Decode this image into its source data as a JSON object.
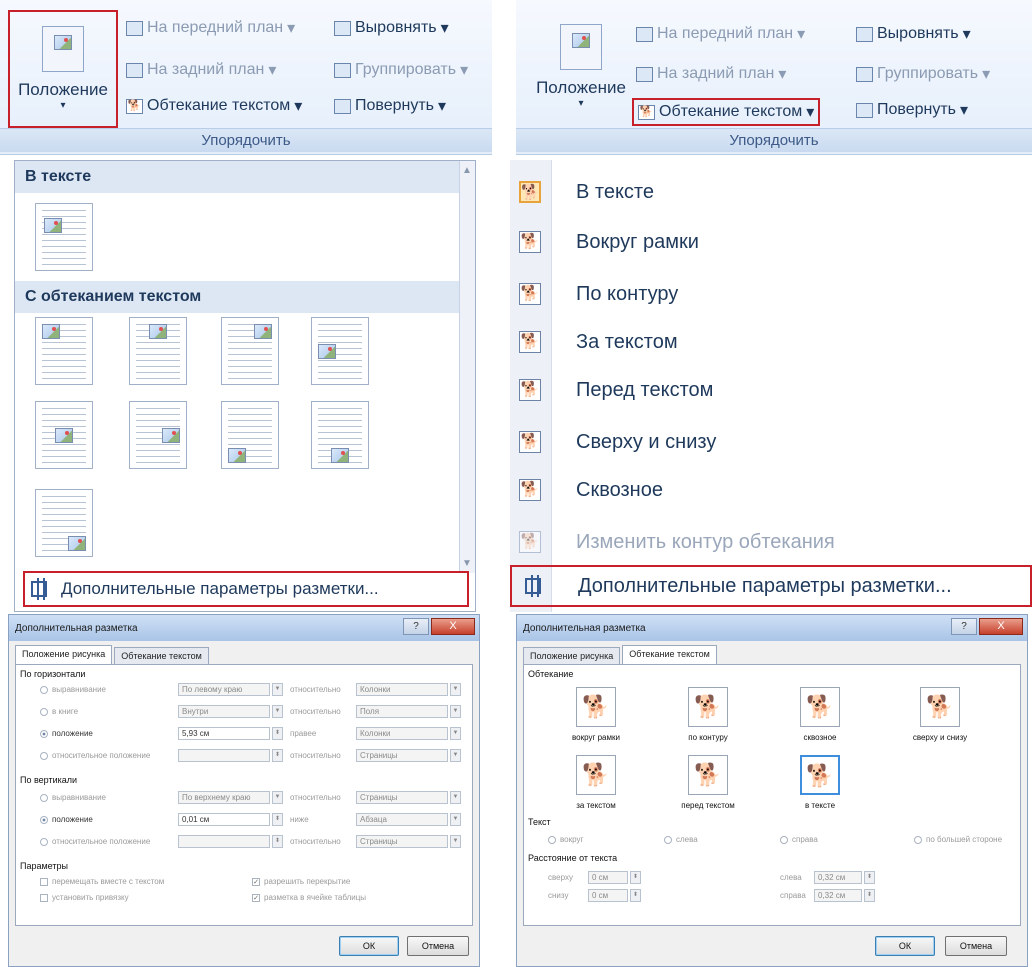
{
  "ribbon": {
    "position_label": "Положение",
    "bring_front": "На передний план",
    "send_back": "На задний план",
    "text_wrap": "Обтекание текстом",
    "align": "Выровнять",
    "group": "Группировать",
    "rotate": "Повернуть",
    "group_label": "Упорядочить",
    "dropdown_arrow": "▾",
    "wrap_glyph": "🐕"
  },
  "gallery": {
    "in_text_header": "В тексте",
    "with_wrap_header": "С обтеканием текстом",
    "more_options": "Дополнительные параметры разметки..."
  },
  "menu": {
    "items": [
      {
        "label": "В тексте"
      },
      {
        "label": "Вокруг рамки"
      },
      {
        "label": "По контуру"
      },
      {
        "label": "За текстом"
      },
      {
        "label": "Перед текстом"
      },
      {
        "label": "Сверху и снизу"
      },
      {
        "label": "Сквозное"
      },
      {
        "label": "Изменить контур обтекания"
      },
      {
        "label": "Дополнительные параметры разметки..."
      }
    ]
  },
  "dialog_left": {
    "title": "Дополнительная разметка",
    "help": "?",
    "close": "X",
    "tabs": [
      "Положение рисунка",
      "Обтекание текстом"
    ],
    "horizontal": "По горизонтали",
    "vertical": "По вертикали",
    "params": "Параметры",
    "h_rows": [
      {
        "label": "выравнивание",
        "value": "По левому краю",
        "rel": "относительно",
        "rel_value": "Колонки"
      },
      {
        "label": "в книге",
        "value": "Внутри",
        "rel": "относительно",
        "rel_value": "Поля"
      },
      {
        "label": "положение",
        "value": "5,93 см",
        "rel": "правее",
        "rel_value": "Колонки"
      },
      {
        "label": "относительное положение",
        "value": "",
        "rel": "относительно",
        "rel_value": "Страницы"
      }
    ],
    "v_rows": [
      {
        "label": "выравнивание",
        "value": "По верхнему краю",
        "rel": "относительно",
        "rel_value": "Страницы"
      },
      {
        "label": "положение",
        "value": "0,01 см",
        "rel": "ниже",
        "rel_value": "Абзаца"
      },
      {
        "label": "относительное положение",
        "value": "",
        "rel": "относительно",
        "rel_value": "Страницы"
      }
    ],
    "checks": [
      "перемещать вместе с текстом",
      "установить привязку",
      "разрешить перекрытие",
      "разметка в ячейке таблицы"
    ],
    "ok": "ОК",
    "cancel": "Отмена"
  },
  "dialog_right": {
    "title": "Дополнительная разметка",
    "help": "?",
    "close": "X",
    "tabs": [
      "Положение рисунка",
      "Обтекание текстом"
    ],
    "wrap_section": "Обтекание",
    "wrap_options": [
      "вокруг рамки",
      "по контуру",
      "сквозное",
      "сверху и снизу",
      "за текстом",
      "перед текстом",
      "в тексте"
    ],
    "text_section": "Текст",
    "text_options": [
      "вокруг",
      "слева",
      "справа",
      "по большей стороне"
    ],
    "distance_section": "Расстояние от текста",
    "top_label": "сверху",
    "top_value": "0 см",
    "bottom_label": "снизу",
    "bottom_value": "0 см",
    "left_label": "слева",
    "left_value": "0,32 см",
    "right_label": "справа",
    "right_value": "0,32 см",
    "ok": "ОК",
    "cancel": "Отмена"
  }
}
